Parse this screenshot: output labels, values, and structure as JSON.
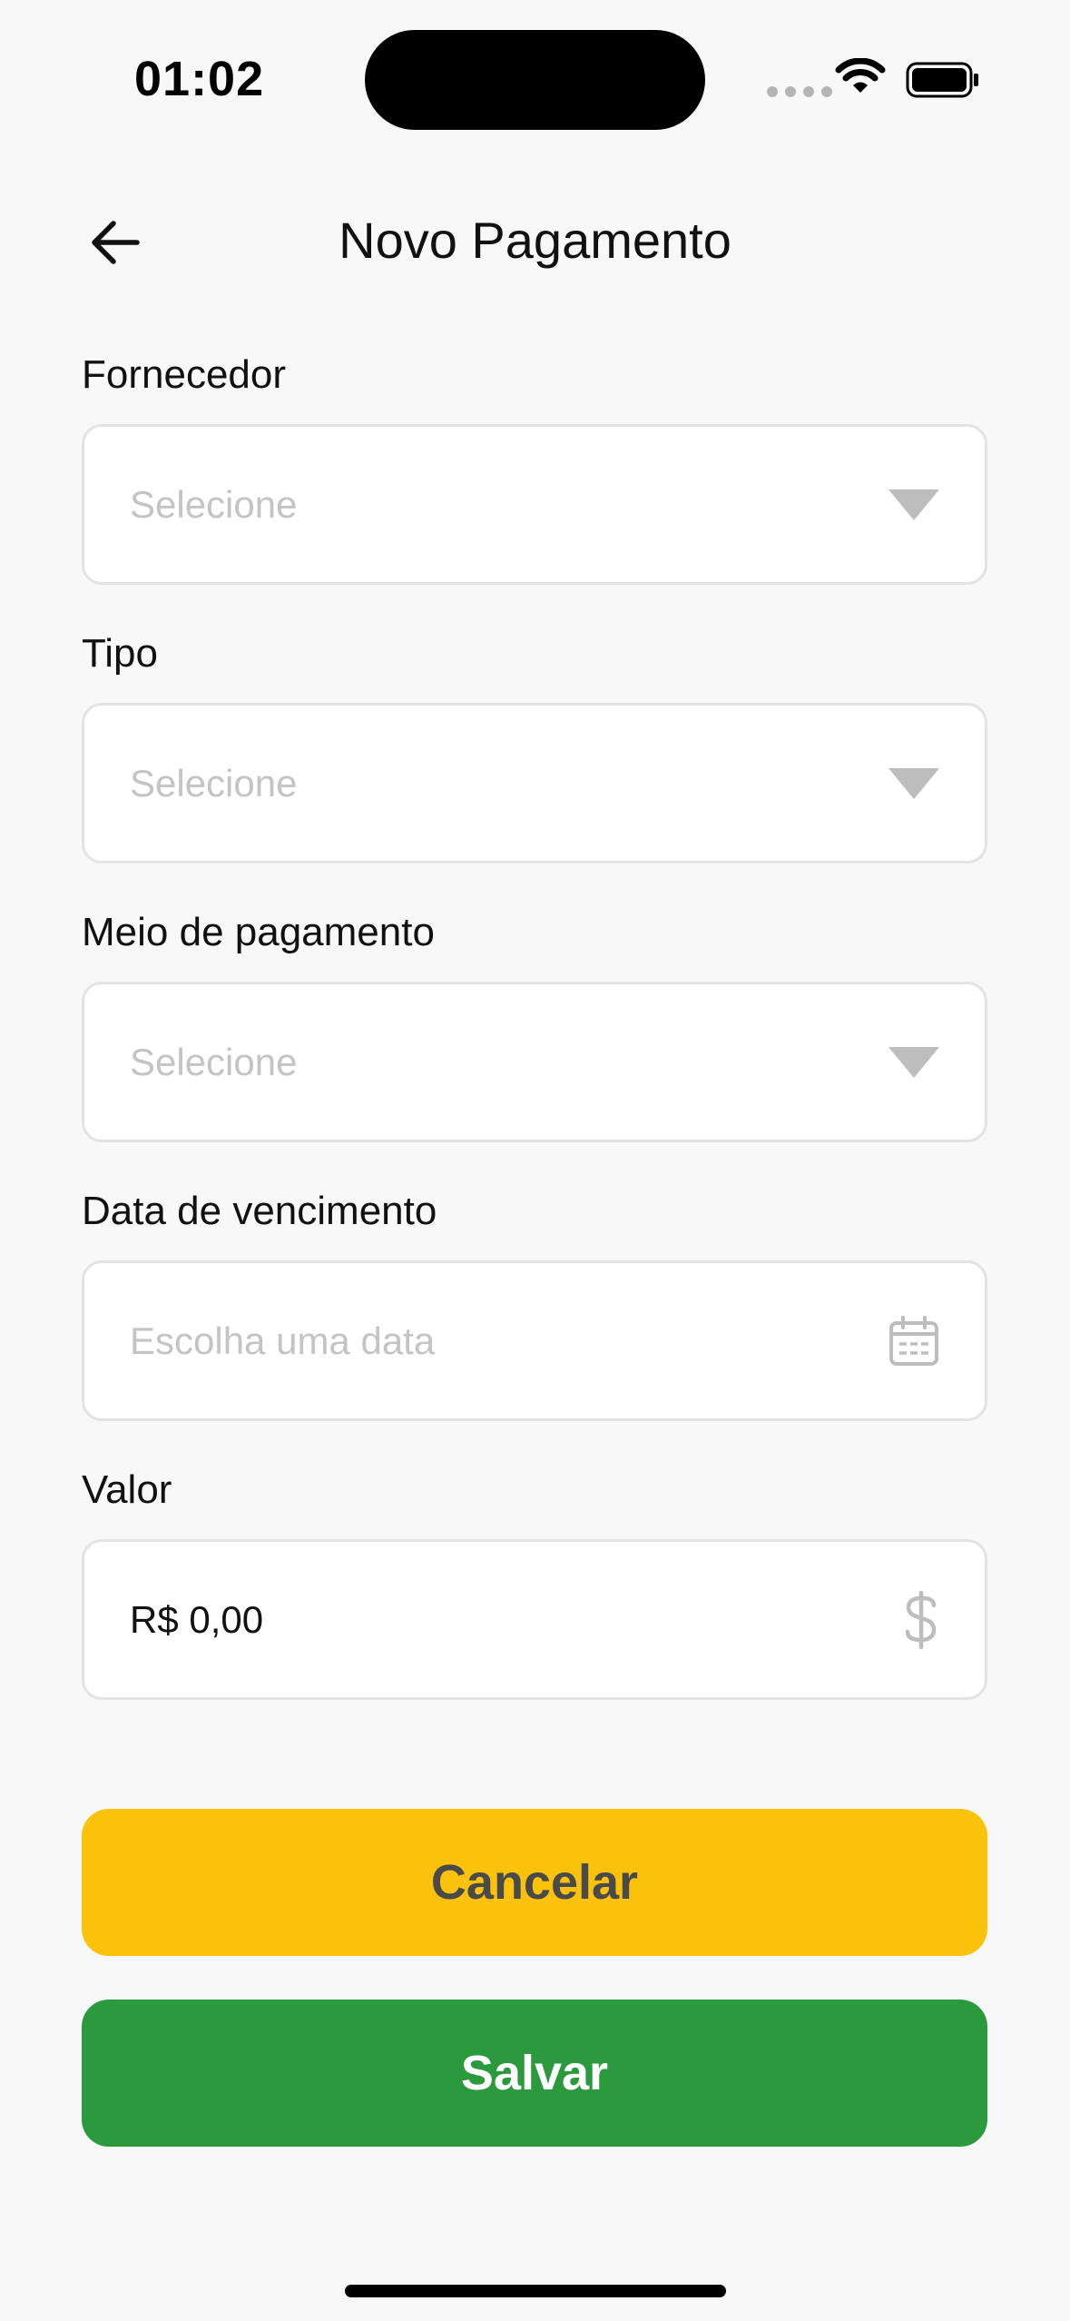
{
  "status_bar": {
    "time": "01:02"
  },
  "header": {
    "title": "Novo Pagamento",
    "back_icon": "arrow-left-icon"
  },
  "form": {
    "fornecedor": {
      "label": "Fornecedor",
      "placeholder": "Selecione",
      "icon": "chevron-down-icon"
    },
    "tipo": {
      "label": "Tipo",
      "placeholder": "Selecione",
      "icon": "chevron-down-icon"
    },
    "meio_pagamento": {
      "label": "Meio de pagamento",
      "placeholder": "Selecione",
      "icon": "chevron-down-icon"
    },
    "data_vencimento": {
      "label": "Data de vencimento",
      "placeholder": "Escolha uma data",
      "icon": "calendar-icon"
    },
    "valor": {
      "label": "Valor",
      "value": "R$ 0,00",
      "icon": "dollar-icon"
    }
  },
  "actions": {
    "cancel_label": "Cancelar",
    "save_label": "Salvar"
  },
  "colors": {
    "background": "#f8f8f8",
    "cancel_button": "#fbc20c",
    "save_button": "#2a9a3d",
    "placeholder": "#c4c4c4",
    "icon_gray": "#bdbdbd"
  }
}
